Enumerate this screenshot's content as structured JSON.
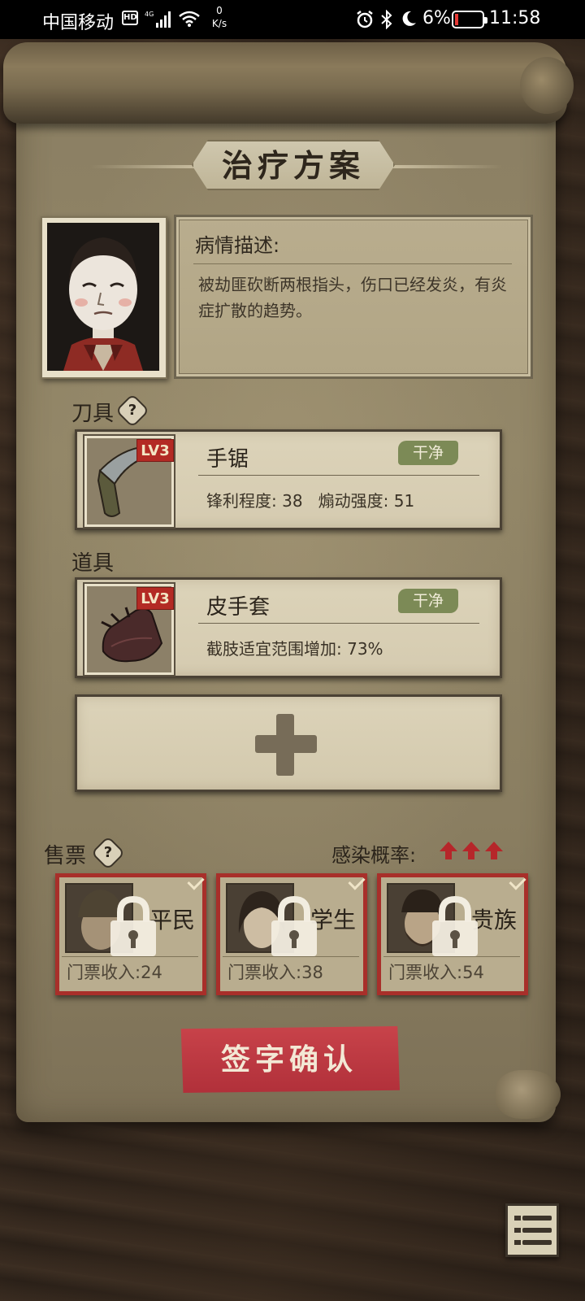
{
  "status_bar": {
    "carrier": "中国移动",
    "hd_badge": "HD",
    "network_type": "4G",
    "net_speed_value": "0",
    "net_speed_unit": "K/s",
    "battery_percent": "6%",
    "time": "11:58"
  },
  "title": "治疗方案",
  "condition": {
    "label": "病情描述:",
    "text": "被劫匪砍断两根指头，伤口已经发炎，有炎症扩散的趋势。"
  },
  "tool_section": {
    "label": "刀具",
    "help": "?",
    "item": {
      "level": "LV3",
      "name": "手锯",
      "tag": "干净",
      "stat1_label": "锋利程度:",
      "stat1_value": "38",
      "stat2_label": "煽动强度:",
      "stat2_value": "51"
    }
  },
  "prop_section": {
    "label": "道具",
    "item": {
      "level": "LV3",
      "name": "皮手套",
      "tag": "干净",
      "stat_label": "截肢适宜范围增加:",
      "stat_value": "73%"
    }
  },
  "tickets_section": {
    "label": "售票",
    "help": "?",
    "infection_label": "感染概率:",
    "infection_level": 3,
    "tickets": [
      {
        "name": "平民",
        "income_label": "门票收入:",
        "income": "24"
      },
      {
        "name": "学生",
        "income_label": "门票收入:",
        "income": "38"
      },
      {
        "name": "贵族",
        "income_label": "门票收入:",
        "income": "54"
      }
    ]
  },
  "confirm_button": "签字确认",
  "colors": {
    "accent_red": "#b1303a",
    "tag_green": "#7c8a56",
    "parchment": "#dcd3b9"
  },
  "icons": {
    "signal": "signal-icon",
    "wifi": "wifi-icon",
    "alarm": "alarm-icon",
    "bluetooth": "bluetooth-icon",
    "moon": "moon-icon",
    "lock": "lock-icon",
    "add": "plus-icon",
    "menu": "menu-list-icon"
  }
}
